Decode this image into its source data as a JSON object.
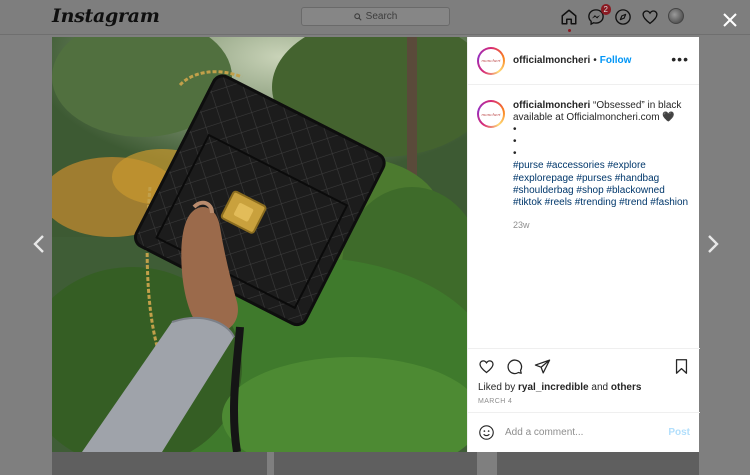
{
  "nav": {
    "logo": "Instagram",
    "search_placeholder": "Search",
    "messages_badge": "2",
    "icons": [
      "home-icon",
      "messenger-icon",
      "explore-icon",
      "heart-icon",
      "profile-avatar"
    ]
  },
  "post": {
    "username": "officialmoncheri",
    "separator": "•",
    "follow_label": "Follow",
    "more_label": "•••",
    "avatar_text": "moncheri",
    "caption_user": "officialmoncheri",
    "caption_text": " “Obsessed” in black available at Officialmoncheri.com 🖤",
    "bullets": [
      "•",
      "•",
      "•"
    ],
    "hashtags": "#purse #accessories #explore #explorepage #purses #handbag #shoulderbag #shop #blackowned #tiktok #reels #trending #trend #fashion",
    "age": "23w",
    "liked_prefix": "Liked by ",
    "liked_user": "ryal_incredible",
    "liked_and": " and ",
    "liked_others": "others",
    "date": "MARCH 4",
    "comment_placeholder": "Add a comment...",
    "post_label": "Post"
  },
  "colors": {
    "link_blue": "#0095f6",
    "hashtag": "#00376b",
    "post_disabled": "#b2dffc",
    "badge": "#8a1a22"
  }
}
